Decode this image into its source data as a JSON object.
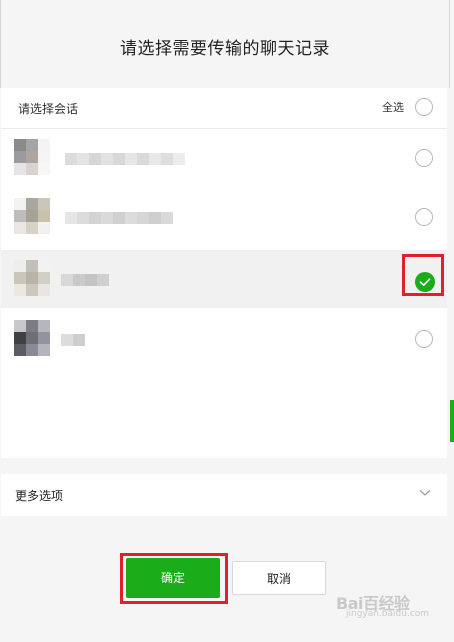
{
  "dialog": {
    "title": "请选择需要传输的聊天记录"
  },
  "list": {
    "header_label": "请选择会话",
    "select_all_label": "全选",
    "rows": [
      {
        "selected": false
      },
      {
        "selected": false
      },
      {
        "selected": true
      },
      {
        "selected": false
      }
    ]
  },
  "more_options": {
    "label": "更多选项"
  },
  "buttons": {
    "confirm_label": "确定",
    "cancel_label": "取消"
  },
  "watermark": {
    "main": "Bai百经验",
    "sub": "jingyan.baidu.com"
  },
  "colors": {
    "accent_green": "#1aad19",
    "highlight_red": "#e0212b"
  },
  "icons": {
    "chevron": "chevron-down-icon",
    "check": "checkmark-icon"
  }
}
